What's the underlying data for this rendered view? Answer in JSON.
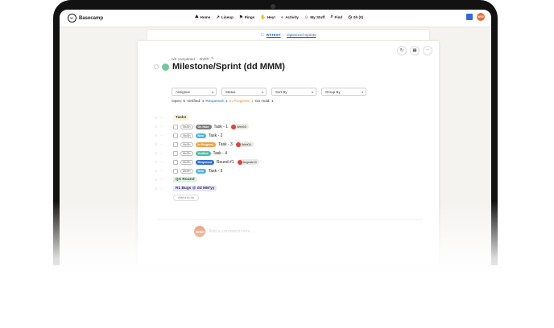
{
  "nav": {
    "logo": "Basecamp",
    "items": [
      {
        "icon": "⛰",
        "label": "Home"
      },
      {
        "icon": "↗",
        "label": "Lineup"
      },
      {
        "icon": "⚑",
        "label": "Pings"
      },
      {
        "icon": "✋",
        "label": "Hey!"
      },
      {
        "icon": "◐",
        "label": "Activity"
      },
      {
        "icon": "☺",
        "label": "My Stuff"
      },
      {
        "icon": "⌕",
        "label": "Find"
      },
      {
        "icon": "◷",
        "label": "0h (0)"
      }
    ],
    "avatar": "WS0"
  },
  "breadcrumb": {
    "project": "RTTEST",
    "sep": "›",
    "list": "Optimized Sprints"
  },
  "milestone": {
    "completed": "0/6 completed",
    "due": "· 0h/0h",
    "title": "Milestone/Sprint (dd MMM)"
  },
  "filters": [
    "Assignee",
    "Status",
    "Sort By",
    "Group By"
  ],
  "counts": {
    "open": "Open: 6",
    "verified": "Verified: 1",
    "reopened": "Reopened: 1",
    "in_progress": "In Progress: 1",
    "on_hold": "On Hold: 1"
  },
  "groups": {
    "tasks": "Tasks",
    "qa": "QA Round",
    "bugs": "R1 Bugs @ dd MM'yy"
  },
  "tasks": [
    {
      "date": "0h/0h",
      "status": "On Hold",
      "status_color": "#7b7b7b",
      "name": "Task - 1",
      "assignee": "Web03"
    },
    {
      "date": "0h/0h",
      "status": "New",
      "status_color": "#4fb3e8",
      "name": "Task - 2",
      "assignee": ""
    },
    {
      "date": "0h/0h",
      "status": "In Progress",
      "status_color": "#f0a046",
      "name": "Task - 3",
      "assignee": "Web04"
    },
    {
      "date": "0h/0h",
      "status": "Verified",
      "status_color": "#4fbfa5",
      "name": "Task - 4",
      "assignee": ""
    },
    {
      "date": "0h/0h",
      "status": "Reopened",
      "status_color": "#2f6fd0",
      "name": "Round #1",
      "assignee": "Angular10"
    },
    {
      "date": "0h/0h",
      "status": "New",
      "status_color": "#4fb3e8",
      "name": "Task - 5",
      "assignee": ""
    }
  ],
  "add_todo": "Add a to-do",
  "comment": {
    "avatar": "WS0",
    "placeholder": "Add a comment here..."
  },
  "colors": {
    "accent": "#1c62c7",
    "completed_check": "#74c69d",
    "avatar": "#e0703a"
  }
}
